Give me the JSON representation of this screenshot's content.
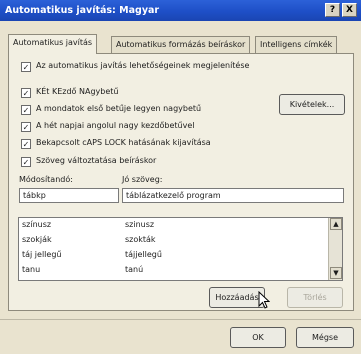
{
  "window": {
    "title": "Automatikus javítás: Magyar",
    "help_btn": "?",
    "close_btn": "X"
  },
  "tabs": [
    {
      "label": "Automatikus javítás"
    },
    {
      "label": "Automatikus formázás beíráskor"
    },
    {
      "label": "Intelligens címkék"
    }
  ],
  "options": {
    "show_buttons": {
      "label": "Az automatikus javítás lehetőségeinek megjelenítése",
      "checked": true
    },
    "two_initial_caps": {
      "label": "KÉt KEzdő NAgybetű",
      "checked": true
    },
    "capitalize_sentence": {
      "label": "A mondatok első betűje legyen nagybetű",
      "checked": true
    },
    "capitalize_days": {
      "label": "A hét napjai angolul nagy kezdőbetűvel",
      "checked": true
    },
    "caps_lock": {
      "label": "Bekapcsolt cAPS LOCK hatásának kijavítása",
      "checked": true
    },
    "replace_text": {
      "label": "Szöveg változtatása beíráskor",
      "checked": true
    }
  },
  "exceptions_btn": "Kivételek...",
  "fields": {
    "replace_label": "Módosítandó:",
    "with_label": "Jó szöveg:",
    "replace_value": "tábkp",
    "with_value": "táblázatkezelő program"
  },
  "entries": [
    {
      "from": "színusz",
      "to": "szinusz"
    },
    {
      "from": "szokják",
      "to": "szokták"
    },
    {
      "from": "táj jellegű",
      "to": "tájjellegű"
    },
    {
      "from": "tanu",
      "to": "tanú"
    }
  ],
  "buttons": {
    "add": "Hozzáadás",
    "delete": "Törlés",
    "ok": "OK",
    "cancel": "Mégse"
  },
  "icons": {
    "scroll_up": "▲",
    "scroll_down": "▼",
    "checkmark": "✓"
  }
}
